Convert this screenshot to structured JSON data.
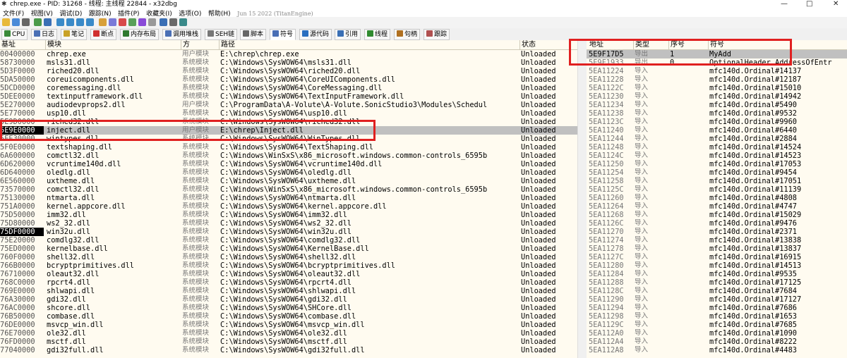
{
  "window": {
    "title": "chrep.exe - PID: 31268 - 线程: 主线程 22844 - x32dbg",
    "date": "Jun 15 2022 (TitanEngine)",
    "controls": [
      "—",
      "□",
      "✕"
    ]
  },
  "menu": [
    "文件(F)",
    "视图(V)",
    "调试(D)",
    "跟踪(N)",
    "插件(P)",
    "收藏夹(I)",
    "选项(O)",
    "帮助(H)"
  ],
  "tabs": [
    {
      "label": "CPU",
      "color": "#3a8a3a"
    },
    {
      "label": "日志",
      "color": "#4a6fb5"
    },
    {
      "label": "笔记",
      "color": "#c9a227"
    },
    {
      "label": "断点",
      "color": "#d03030"
    },
    {
      "label": "内存布局",
      "color": "#2f7a2f"
    },
    {
      "label": "调用堆栈",
      "color": "#4a6fb5"
    },
    {
      "label": "SEH链",
      "color": "#777777"
    },
    {
      "label": "脚本",
      "color": "#666666"
    },
    {
      "label": "符号",
      "color": "#4a6fb5"
    },
    {
      "label": "源代码",
      "color": "#2a6fc0"
    },
    {
      "label": "引用",
      "color": "#3a6fb5"
    },
    {
      "label": "线程",
      "color": "#2f8a2f"
    },
    {
      "label": "句柄",
      "color": "#b07020"
    },
    {
      "label": "跟踪",
      "color": "#b05050"
    }
  ],
  "left_panel": {
    "headers": [
      "基址",
      "模块",
      "方",
      "路径",
      "状态"
    ],
    "rows": [
      {
        "base": "00400000",
        "module": "chrep.exe",
        "party": "用户模块",
        "path": "E:\\chrep\\chrep.exe",
        "status": "Unloaded"
      },
      {
        "base": "58730000",
        "module": "msls31.dll",
        "party": "系统模块",
        "path": "C:\\Windows\\SysWOW64\\msls31.dll",
        "status": "Unloaded"
      },
      {
        "base": "5D3F0000",
        "module": "riched20.dll",
        "party": "系统模块",
        "path": "C:\\Windows\\SysWOW64\\riched20.dll",
        "status": "Unloaded"
      },
      {
        "base": "5DA50000",
        "module": "coreuicomponents.dll",
        "party": "系统模块",
        "path": "C:\\Windows\\SysWOW64\\CoreUIComponents.dll",
        "status": "Unloaded"
      },
      {
        "base": "5DCD0000",
        "module": "coremessaging.dll",
        "party": "系统模块",
        "path": "C:\\Windows\\SysWOW64\\CoreMessaging.dll",
        "status": "Unloaded"
      },
      {
        "base": "5DEE0000",
        "module": "textinputframework.dll",
        "party": "系统模块",
        "path": "C:\\Windows\\SysWOW64\\TextInputFramework.dll",
        "status": "Unloaded"
      },
      {
        "base": "5E270000",
        "module": "audiodevprops2.dll",
        "party": "用户模块",
        "path": "C:\\ProgramData\\A-Volute\\A-Volute.SonicStudio3\\Modules\\Schedul",
        "status": "Unloaded"
      },
      {
        "base": "5E770000",
        "module": "usp10.dll",
        "party": "系统模块",
        "path": "C:\\Windows\\SysWOW64\\usp10.dll",
        "status": "Unloaded"
      },
      {
        "base": "5E9D0000",
        "module": "riched32.dll",
        "party": "系统模块",
        "path": "C:\\Windows\\SysWOW64\\riched32.dll",
        "status": "Unloaded"
      },
      {
        "base": "5E9E0000",
        "module": "inject.dll",
        "party": "用户模块",
        "path": "E:\\chrep\\Inject.dll",
        "status": "Unloaded",
        "selected": true
      },
      {
        "base": "5EE30000",
        "module": "wintypes.dll",
        "party": "系统模块",
        "path": "C:\\Windows\\SysWOW64\\WinTypes.dll",
        "status": "Unloaded"
      },
      {
        "base": "5F0E0000",
        "module": "textshaping.dll",
        "party": "系统模块",
        "path": "C:\\Windows\\SysWOW64\\TextShaping.dll",
        "status": "Unloaded"
      },
      {
        "base": "6A600000",
        "module": "comctl32.dll",
        "party": "系统模块",
        "path": "C:\\Windows\\WinSxS\\x86_microsoft.windows.common-controls_6595b",
        "status": "Unloaded"
      },
      {
        "base": "6D620000",
        "module": "vcruntime140d.dll",
        "party": "系统模块",
        "path": "C:\\Windows\\SysWOW64\\vcruntime140d.dll",
        "status": "Unloaded"
      },
      {
        "base": "6D640000",
        "module": "oledlg.dll",
        "party": "系统模块",
        "path": "C:\\Windows\\SysWOW64\\oledlg.dll",
        "status": "Unloaded"
      },
      {
        "base": "6E560000",
        "module": "uxtheme.dll",
        "party": "系统模块",
        "path": "C:\\Windows\\SysWOW64\\uxtheme.dll",
        "status": "Unloaded"
      },
      {
        "base": "73570000",
        "module": "comctl32.dll",
        "party": "系统模块",
        "path": "C:\\Windows\\WinSxS\\x86_microsoft.windows.common-controls_6595b",
        "status": "Unloaded"
      },
      {
        "base": "75130000",
        "module": "ntmarta.dll",
        "party": "系统模块",
        "path": "C:\\Windows\\SysWOW64\\ntmarta.dll",
        "status": "Unloaded"
      },
      {
        "base": "751A0000",
        "module": "kernel.appcore.dll",
        "party": "系统模块",
        "path": "C:\\Windows\\SysWOW64\\kernel.appcore.dll",
        "status": "Unloaded"
      },
      {
        "base": "75D50000",
        "module": "imm32.dll",
        "party": "系统模块",
        "path": "C:\\Windows\\SysWOW64\\imm32.dll",
        "status": "Unloaded"
      },
      {
        "base": "75D80000",
        "module": "ws2_32.dll",
        "party": "系统模块",
        "path": "C:\\Windows\\SysWOW64\\ws2_32.dll",
        "status": "Unloaded"
      },
      {
        "base": "75DF0000",
        "module": "win32u.dll",
        "party": "系统模块",
        "path": "C:\\Windows\\SysWOW64\\win32u.dll",
        "status": "Unloaded",
        "hl": true
      },
      {
        "base": "75E20000",
        "module": "comdlg32.dll",
        "party": "系统模块",
        "path": "C:\\Windows\\SysWOW64\\comdlg32.dll",
        "status": "Unloaded"
      },
      {
        "base": "75ED0000",
        "module": "kernelbase.dll",
        "party": "系统模块",
        "path": "C:\\Windows\\SysWOW64\\KernelBase.dll",
        "status": "Unloaded"
      },
      {
        "base": "760F0000",
        "module": "shell32.dll",
        "party": "系统模块",
        "path": "C:\\Windows\\SysWOW64\\shell32.dll",
        "status": "Unloaded"
      },
      {
        "base": "766B0000",
        "module": "bcryptprimitives.dll",
        "party": "系统模块",
        "path": "C:\\Windows\\SysWOW64\\bcryptprimitives.dll",
        "status": "Unloaded"
      },
      {
        "base": "76710000",
        "module": "oleaut32.dll",
        "party": "系统模块",
        "path": "C:\\Windows\\SysWOW64\\oleaut32.dll",
        "status": "Unloaded"
      },
      {
        "base": "768C0000",
        "module": "rpcrt4.dll",
        "party": "系统模块",
        "path": "C:\\Windows\\SysWOW64\\rpcrt4.dll",
        "status": "Unloaded"
      },
      {
        "base": "769E0000",
        "module": "shlwapi.dll",
        "party": "系统模块",
        "path": "C:\\Windows\\SysWOW64\\shlwapi.dll",
        "status": "Unloaded"
      },
      {
        "base": "76A30000",
        "module": "gdi32.dll",
        "party": "系统模块",
        "path": "C:\\Windows\\SysWOW64\\gdi32.dll",
        "status": "Unloaded"
      },
      {
        "base": "76AC0000",
        "module": "shcore.dll",
        "party": "系统模块",
        "path": "C:\\Windows\\SysWOW64\\SHCore.dll",
        "status": "Unloaded"
      },
      {
        "base": "76B50000",
        "module": "combase.dll",
        "party": "系统模块",
        "path": "C:\\Windows\\SysWOW64\\combase.dll",
        "status": "Unloaded"
      },
      {
        "base": "76DE0000",
        "module": "msvcp_win.dll",
        "party": "系统模块",
        "path": "C:\\Windows\\SysWOW64\\msvcp_win.dll",
        "status": "Unloaded"
      },
      {
        "base": "76E70000",
        "module": "ole32.dll",
        "party": "系统模块",
        "path": "C:\\Windows\\SysWOW64\\ole32.dll",
        "status": "Unloaded"
      },
      {
        "base": "76FD0000",
        "module": "msctf.dll",
        "party": "系统模块",
        "path": "C:\\Windows\\SysWOW64\\msctf.dll",
        "status": "Unloaded"
      },
      {
        "base": "77040000",
        "module": "gdi32full.dll",
        "party": "系统模块",
        "path": "C:\\Windows\\SysWOW64\\gdi32full.dll",
        "status": "Unloaded"
      }
    ]
  },
  "right_panel": {
    "headers": [
      "地址",
      "类型",
      "序号",
      "符号"
    ],
    "rows": [
      {
        "addr": "5E9F17D5",
        "type": "导出",
        "ord": "1",
        "sym": "MyAdd",
        "first": true
      },
      {
        "addr": "5E9F1933",
        "type": "导出",
        "ord": "0",
        "sym": "OptionalHeader.AddressOfEntr"
      },
      {
        "addr": "5EA11224",
        "type": "导入",
        "ord": "",
        "sym": "mfc140d.Ordinal#14137"
      },
      {
        "addr": "5EA11228",
        "type": "导入",
        "ord": "",
        "sym": "mfc140d.Ordinal#12187"
      },
      {
        "addr": "5EA1122C",
        "type": "导入",
        "ord": "",
        "sym": "mfc140d.Ordinal#15010"
      },
      {
        "addr": "5EA11230",
        "type": "导入",
        "ord": "",
        "sym": "mfc140d.Ordinal#14942"
      },
      {
        "addr": "5EA11234",
        "type": "导入",
        "ord": "",
        "sym": "mfc140d.Ordinal#5490"
      },
      {
        "addr": "5EA11238",
        "type": "导入",
        "ord": "",
        "sym": "mfc140d.Ordinal#9532"
      },
      {
        "addr": "5EA1123C",
        "type": "导入",
        "ord": "",
        "sym": "mfc140d.Ordinal#9960"
      },
      {
        "addr": "5EA11240",
        "type": "导入",
        "ord": "",
        "sym": "mfc140d.Ordinal#6440"
      },
      {
        "addr": "5EA11244",
        "type": "导入",
        "ord": "",
        "sym": "mfc140d.Ordinal#2884"
      },
      {
        "addr": "5EA11248",
        "type": "导入",
        "ord": "",
        "sym": "mfc140d.Ordinal#14524"
      },
      {
        "addr": "5EA1124C",
        "type": "导入",
        "ord": "",
        "sym": "mfc140d.Ordinal#14523"
      },
      {
        "addr": "5EA11250",
        "type": "导入",
        "ord": "",
        "sym": "mfc140d.Ordinal#17053"
      },
      {
        "addr": "5EA11254",
        "type": "导入",
        "ord": "",
        "sym": "mfc140d.Ordinal#9454"
      },
      {
        "addr": "5EA11258",
        "type": "导入",
        "ord": "",
        "sym": "mfc140d.Ordinal#17051"
      },
      {
        "addr": "5EA1125C",
        "type": "导入",
        "ord": "",
        "sym": "mfc140d.Ordinal#11139"
      },
      {
        "addr": "5EA11260",
        "type": "导入",
        "ord": "",
        "sym": "mfc140d.Ordinal#4808"
      },
      {
        "addr": "5EA11264",
        "type": "导入",
        "ord": "",
        "sym": "mfc140d.Ordinal#4747"
      },
      {
        "addr": "5EA11268",
        "type": "导入",
        "ord": "",
        "sym": "mfc140d.Ordinal#15029"
      },
      {
        "addr": "5EA1126C",
        "type": "导入",
        "ord": "",
        "sym": "mfc140d.Ordinal#9476"
      },
      {
        "addr": "5EA11270",
        "type": "导入",
        "ord": "",
        "sym": "mfc140d.Ordinal#2371"
      },
      {
        "addr": "5EA11274",
        "type": "导入",
        "ord": "",
        "sym": "mfc140d.Ordinal#13838"
      },
      {
        "addr": "5EA11278",
        "type": "导入",
        "ord": "",
        "sym": "mfc140d.Ordinal#13837"
      },
      {
        "addr": "5EA1127C",
        "type": "导入",
        "ord": "",
        "sym": "mfc140d.Ordinal#16915"
      },
      {
        "addr": "5EA11280",
        "type": "导入",
        "ord": "",
        "sym": "mfc140d.Ordinal#14513"
      },
      {
        "addr": "5EA11284",
        "type": "导入",
        "ord": "",
        "sym": "mfc140d.Ordinal#9535"
      },
      {
        "addr": "5EA11288",
        "type": "导入",
        "ord": "",
        "sym": "mfc140d.Ordinal#17125"
      },
      {
        "addr": "5EA1128C",
        "type": "导入",
        "ord": "",
        "sym": "mfc140d.Ordinal#7684"
      },
      {
        "addr": "5EA11290",
        "type": "导入",
        "ord": "",
        "sym": "mfc140d.Ordinal#17127"
      },
      {
        "addr": "5EA11294",
        "type": "导入",
        "ord": "",
        "sym": "mfc140d.Ordinal#7686"
      },
      {
        "addr": "5EA11298",
        "type": "导入",
        "ord": "",
        "sym": "mfc140d.Ordinal#1653"
      },
      {
        "addr": "5EA1129C",
        "type": "导入",
        "ord": "",
        "sym": "mfc140d.Ordinal#7685"
      },
      {
        "addr": "5EA112A0",
        "type": "导入",
        "ord": "",
        "sym": "mfc140d.Ordinal#1090"
      },
      {
        "addr": "5EA112A4",
        "type": "导入",
        "ord": "",
        "sym": "mfc140d.Ordinal#8222"
      },
      {
        "addr": "5EA112A8",
        "type": "导入",
        "ord": "",
        "sym": "mfc140d.Ordinal#4483"
      }
    ]
  },
  "colors": {
    "highlight_box": "#e02020",
    "panel_bg": "#fffbf0",
    "selected_row": "#c0c0c0"
  }
}
